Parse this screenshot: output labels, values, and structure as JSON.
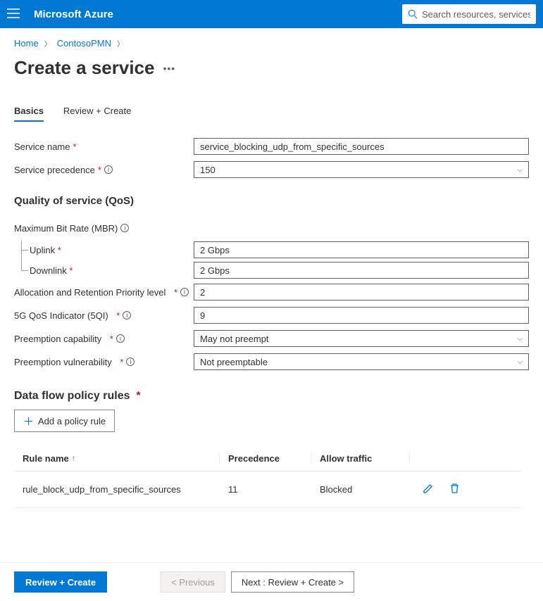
{
  "topbar": {
    "brand": "Microsoft Azure",
    "search_placeholder": "Search resources, services, and docs"
  },
  "breadcrumb": {
    "home": "Home",
    "resource": "ContosoPMN"
  },
  "page": {
    "title": "Create a service"
  },
  "tabs": {
    "basics": "Basics",
    "review": "Review + Create"
  },
  "form": {
    "service_name_label": "Service name",
    "service_name_value": "service_blocking_udp_from_specific_sources",
    "precedence_label": "Service precedence",
    "precedence_value": "150"
  },
  "qos": {
    "heading": "Quality of service (QoS)",
    "mbr_label": "Maximum Bit Rate (MBR)",
    "uplink_label": "Uplink",
    "uplink_value": "2 Gbps",
    "downlink_label": "Downlink",
    "downlink_value": "2 Gbps",
    "arp_label": "Allocation and Retention Priority level",
    "arp_value": "2",
    "fiveqi_label": "5G QoS Indicator (5QI)",
    "fiveqi_value": "9",
    "precap_label": "Preemption capability",
    "precap_value": "May not preempt",
    "prevul_label": "Preemption vulnerability",
    "prevul_value": "Not preemptable"
  },
  "dataflow": {
    "heading": "Data flow policy rules",
    "add_label": "Add a policy rule",
    "col_name": "Rule name",
    "col_prec": "Precedence",
    "col_allow": "Allow traffic",
    "rows": [
      {
        "name": "rule_block_udp_from_specific_sources",
        "prec": "11",
        "allow": "Blocked"
      }
    ]
  },
  "footer": {
    "review": "Review + Create",
    "prev": "< Previous",
    "next": "Next : Review + Create >"
  }
}
